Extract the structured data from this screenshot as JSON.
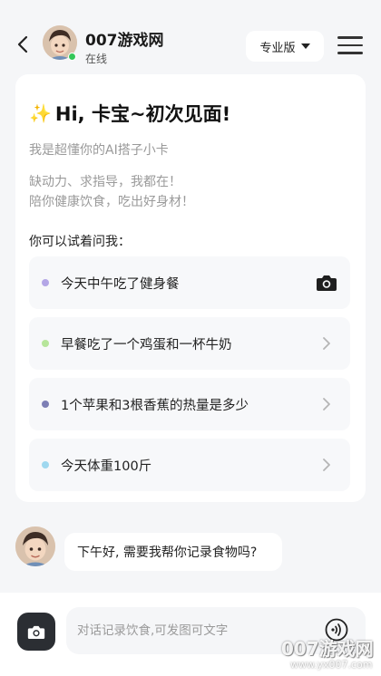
{
  "header": {
    "app_name": "007游戏网",
    "status": "在线",
    "plan": "专业版"
  },
  "card": {
    "greeting": "Hi, 卡宝~初次见面!",
    "greeting_icon": "sparkle-icon",
    "intro": "我是超懂你的AI搭子小卡",
    "tagline_1": "缺动力、求指导，我都在！",
    "tagline_2": "陪你健康饮食，吃出好身材！",
    "prompt_title": "你可以试着问我：",
    "suggestions": [
      {
        "text": "今天中午吃了健身餐",
        "dot_color": "#b3a6e6",
        "icon": "camera-icon"
      },
      {
        "text": "早餐吃了一个鸡蛋和一杯牛奶",
        "dot_color": "#b6e59a",
        "icon": "chevron-right-icon"
      },
      {
        "text": "1个苹果和3根香蕉的热量是多少",
        "dot_color": "#7d7fb5",
        "icon": "chevron-right-icon"
      },
      {
        "text": "今天体重100斤",
        "dot_color": "#9fd8ef",
        "icon": "chevron-right-icon"
      }
    ]
  },
  "chat": {
    "message": "下午好, 需要我帮你记录食物吗?"
  },
  "composer": {
    "placeholder": "对话记录饮食,可发图可文字",
    "camera_icon": "camera-icon",
    "voice_icon": "voice-icon"
  },
  "watermark": {
    "brand": "007游戏网",
    "url": "www.yx007.com"
  },
  "colors": {
    "accent_dark": "#2b2e33",
    "online": "#34c759",
    "background": "#f5f6f8"
  }
}
